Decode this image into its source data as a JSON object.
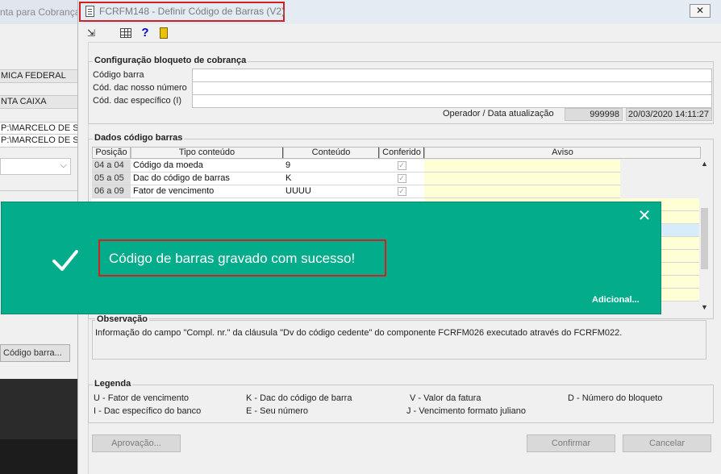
{
  "background_window": {
    "title": "nta para Cobrança",
    "fields": [
      "MICA FEDERAL",
      "NTA CAIXA",
      "P:\\MARCELO DE SO",
      "P:\\MARCELO DE SO"
    ],
    "button_label": "Código barra..."
  },
  "window": {
    "title": "FCRFM148 - Definir Código de Barras (V2)",
    "close_label": "✕"
  },
  "toolbar": {
    "export_icon": "⇲",
    "help_label": "?"
  },
  "config": {
    "group_label": "Configuração bloqueto de cobrança",
    "codigo_barra_label": "Código barra",
    "dac_nosso_numero_label": "Cód. dac nosso número",
    "dac_especifico_label": "Cód. dac específico (I)",
    "operador_label": "Operador / Data atualização",
    "operador_value": "999998",
    "data_value": "20/03/2020 14:11:27"
  },
  "dados": {
    "group_label": "Dados código barras",
    "headers": [
      "Posição",
      "Tipo conteúdo",
      "Conteúdo",
      "Conferido",
      "Aviso"
    ],
    "rows": [
      {
        "posicao": "04 a 04",
        "tipo": "Código da moeda",
        "conteudo": "9",
        "conferido": "✓"
      },
      {
        "posicao": "05 a 05",
        "tipo": "Dac do código de barras",
        "conteudo": "K",
        "conferido": "✓"
      },
      {
        "posicao": "06 a 09",
        "tipo": "Fator de vencimento",
        "conteudo": "UUUU",
        "conferido": "✓"
      }
    ]
  },
  "observacao": {
    "label": "Observação",
    "text": "Informação do campo \"Compl. nr.\" da cláusula \"Dv do código cedente\" do componente FCRFM026 executado através do FCRFM022."
  },
  "legenda": {
    "label": "Legenda",
    "items": [
      "U - Fator de vencimento",
      "K - Dac do código de barra",
      "V - Valor da fatura",
      "D - Número do bloqueto",
      "I - Dac específico do banco",
      "E - Seu número",
      "J - Vencimento formato juliano"
    ]
  },
  "buttons": {
    "aprovacao": "Aprovação...",
    "confirmar": "Confirmar",
    "cancelar": "Cancelar"
  },
  "toast": {
    "message": "Código de barras gravado com sucesso!",
    "more_label": "Adicional...",
    "close_label": "✕",
    "color": "#03ac8b"
  }
}
